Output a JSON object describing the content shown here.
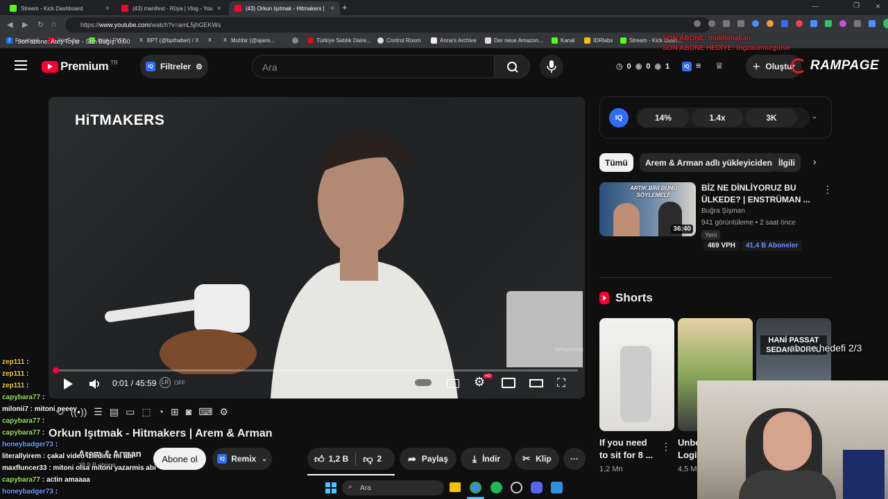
{
  "browser": {
    "tabs": [
      {
        "title": "Stream - Kick Dashboard",
        "color": "#53fc18"
      },
      {
        "title": "(43) manifest - Rüya | Vlog - You",
        "color": "#ff0033"
      },
      {
        "title": "(43) Orkun Işıtmak - Hitmakers |",
        "color": "#ff0033"
      }
    ],
    "url_prefix": "https://",
    "url_host": "www.youtube.com",
    "url_path": "/watch?v=amL5jhGEKWs",
    "bookmarks": [
      "Facebook",
      "YouTube",
      "Kick | RISE",
      "BPT (@bpthaber) / X",
      "Muhbir (@ajans...",
      "Türkiye Satılık Daire...",
      "Control Room",
      "Anna's Archive",
      "Der neue Amazon...",
      "Kanal",
      "IDRlabs",
      "Stream - Kick Dash..."
    ],
    "overlay_top_left": "Son abone: Ateş Toyar - Son Bağış: 0,00"
  },
  "header": {
    "logo_text": "Premium",
    "logo_sup": "TR",
    "filters_label": "Filtreler",
    "search_placeholder": "Ara",
    "counters": [
      "0",
      "0",
      "1"
    ],
    "create_label": "Oluştur"
  },
  "stream_overlay": {
    "line1": "SON ABONE: midillehakan",
    "line2": "SON ABONE HEDİYE: bigzaumozgulse",
    "brand": "RAMPAGE",
    "goal": "abone hedefi 2/3"
  },
  "video": {
    "watermark": "HiTMAKERS",
    "corner_watermark": "HITMAKERS",
    "time": "0:01 / 45:59",
    "toggle_label": "OFF",
    "progress": 0.001,
    "title": "Orkun Işıtmak - Hitmakers | Arem & Arman",
    "channel": "Arem & Arman",
    "subs": "38,9 B abone",
    "subscribe_label": "Abone ol",
    "remix_label": "Remix",
    "likes": "1,2 B",
    "dislikes": "2",
    "share_label": "Paylaş",
    "download_label": "İndir",
    "clip_label": "Klip"
  },
  "iq_panel": {
    "stats": [
      "14%",
      "1.4x",
      "3K"
    ]
  },
  "chips": [
    "Tümü",
    "Arem & Arman adlı yükleyiciden",
    "İlgili"
  ],
  "recommended": {
    "title_line1": "BİZ NE DİNLİYORUZ BU",
    "title_line2": "ÜLKEDE? | ENSTRÜMAN ...",
    "channel": "Buğra Şişman",
    "meta": "941 görüntüleme • 2 saat önce",
    "badge": "Yeni",
    "duration": "36:40",
    "vph": "469 VPH",
    "subs": "41,4 B Aboneler",
    "thumb_text": "ARTIK BİRİ BUNU SÖYLEMELİ!"
  },
  "shorts": {
    "heading": "Shorts",
    "items": [
      {
        "title_line1": "If you need",
        "title_line2": "to sit for 8 ...",
        "views": "1,2 Mn"
      },
      {
        "title_line1": "Unbo",
        "title_line2": "Logit",
        "views": "4,5 M"
      },
      {
        "overlay": "HANİ PASSAT SEDAN YOKTU"
      }
    ]
  },
  "chat": [
    {
      "user": "zep111",
      "msg": "",
      "color": "#f5d142"
    },
    {
      "user": "zep111",
      "msg": "",
      "color": "#f5d142"
    },
    {
      "user": "zep111",
      "msg": "",
      "color": "#f5d142"
    },
    {
      "user": "capybara77",
      "msg": "",
      "color": "#9be564"
    },
    {
      "user": "milonii7",
      "msg": "mitoni neeey",
      "color": "#ffffff"
    },
    {
      "user": "capybara77",
      "msg": "",
      "color": "#9be564"
    },
    {
      "user": "capybara77",
      "msg": "",
      "color": "#9be564"
    },
    {
      "user": "honeybadger73",
      "msg": "",
      "color": "#6aa0ff"
    },
    {
      "user": "literallyirem",
      "msg": "çakal video izledinz mi abi",
      "color": "#ffffff"
    },
    {
      "user": "maxfluncer33",
      "msg": "mitoni olsa mitoni yazarmis abi",
      "color": "#ffffff"
    },
    {
      "user": "capybara77",
      "msg": "actin amaaaa",
      "color": "#9be564"
    },
    {
      "user": "honeybadger73",
      "msg": "",
      "color": "#6aa0ff"
    }
  ],
  "taskbar": {
    "search_label": "Ara"
  }
}
